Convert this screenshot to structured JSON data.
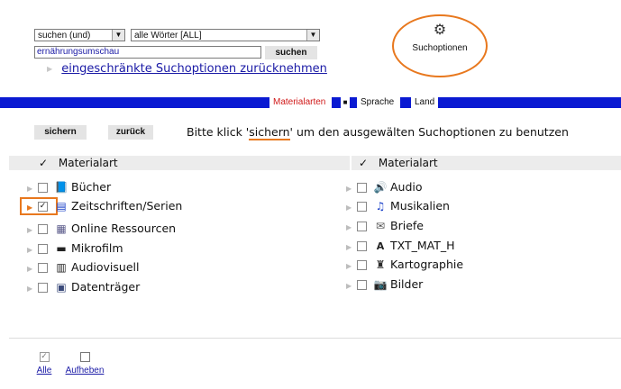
{
  "search": {
    "mode_select": "suchen (und)",
    "words_select": "alle Wörter [ALL]",
    "query": "ernährungsumschau",
    "submit_label": "suchen",
    "reset_link": "eingeschränkte Suchoptionen zurücknehmen"
  },
  "options_button": {
    "label": "Suchoptionen"
  },
  "tabs": {
    "materialarten": "Materialarten",
    "sprache": "Sprache",
    "land": "Land"
  },
  "toolbar": {
    "save_label": "sichern",
    "back_label": "zurück",
    "hint_before": "Bitte klick '",
    "hint_keyword": "sichern",
    "hint_after": "' um den ausgewälten Suchoptionen zu benutzen"
  },
  "columns": [
    {
      "header": "Materialart",
      "items": [
        {
          "label": "Bücher",
          "checked": false,
          "icon": "book-icon"
        },
        {
          "label": "Zeitschriften/Serien",
          "checked": true,
          "icon": "journal-icon"
        },
        {
          "label": "Online Ressourcen",
          "checked": false,
          "icon": "online-icon"
        },
        {
          "label": "Mikrofilm",
          "checked": false,
          "icon": "microfilm-icon"
        },
        {
          "label": "Audiovisuell",
          "checked": false,
          "icon": "film-icon"
        },
        {
          "label": "Datenträger",
          "checked": false,
          "icon": "disk-icon"
        }
      ]
    },
    {
      "header": "Materialart",
      "items": [
        {
          "label": "Audio",
          "checked": false,
          "icon": "speaker-icon"
        },
        {
          "label": "Musikalien",
          "checked": false,
          "icon": "music-icon"
        },
        {
          "label": "Briefe",
          "checked": false,
          "icon": "envelope-icon"
        },
        {
          "label": "TXT_MAT_H",
          "checked": false,
          "icon": "text-icon"
        },
        {
          "label": "Kartographie",
          "checked": false,
          "icon": "map-icon"
        },
        {
          "label": "Bilder",
          "checked": false,
          "icon": "camera-icon"
        }
      ]
    }
  ],
  "footer": {
    "all_label": "Alle",
    "none_label": "Aufheben"
  },
  "colors": {
    "accent_blue": "#0a1ad2",
    "highlight_orange": "#e8781e",
    "tab_red": "#d01818"
  }
}
